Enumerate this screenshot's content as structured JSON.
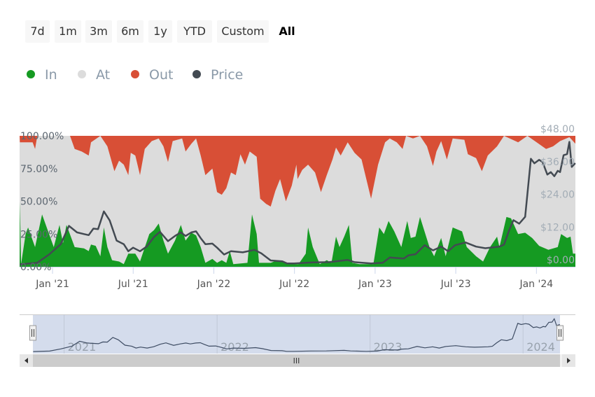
{
  "range_selector": {
    "buttons": [
      "7d",
      "1m",
      "3m",
      "6m",
      "1y",
      "YTD",
      "Custom",
      "All"
    ],
    "selected": "All"
  },
  "legend": [
    {
      "label": "In",
      "color": "#159a22"
    },
    {
      "label": "At",
      "color": "#dcdcdc"
    },
    {
      "label": "Out",
      "color": "#d84f36"
    },
    {
      "label": "Price",
      "color": "#434a52"
    }
  ],
  "navigator": {
    "year_labels": [
      "2021",
      "2022",
      "2023",
      "2024"
    ],
    "scrollbar_grip": "III"
  },
  "chart_data": {
    "type": "area",
    "x_unit": "months since Jan 2021",
    "xlim": [
      -2.45,
      38.9
    ],
    "x_ticks": [
      {
        "m": 0,
        "label": "Jan '21"
      },
      {
        "m": 6,
        "label": "Jul '21"
      },
      {
        "m": 12,
        "label": "Jan '22"
      },
      {
        "m": 18,
        "label": "Jul '22"
      },
      {
        "m": 24,
        "label": "Jan '23"
      },
      {
        "m": 30,
        "label": "Jul '23"
      },
      {
        "m": 36,
        "label": "Jan '24"
      }
    ],
    "y_left": {
      "ticks": [
        "0.00%",
        "25.00%",
        "50.00%",
        "75.00%",
        "100.00%"
      ],
      "range": [
        0,
        100
      ]
    },
    "y_right": {
      "ticks": [
        "$0.00",
        "$12.00",
        "$24.00",
        "$36.00",
        "$48.00"
      ],
      "range": [
        0,
        48
      ]
    },
    "series": [
      {
        "name": "In",
        "unit": "%",
        "points": [
          [
            -2.43,
            50
          ],
          [
            -2.34,
            2
          ],
          [
            -2.0,
            25
          ],
          [
            -1.82,
            30
          ],
          [
            -1.3,
            15
          ],
          [
            -0.78,
            40
          ],
          [
            -0.26,
            25
          ],
          [
            0.09,
            15
          ],
          [
            0.52,
            32
          ],
          [
            0.78,
            18
          ],
          [
            1.04,
            32
          ],
          [
            1.65,
            15
          ],
          [
            2.34,
            14
          ],
          [
            2.69,
            12
          ],
          [
            2.86,
            17
          ],
          [
            3.21,
            16
          ],
          [
            3.56,
            8
          ],
          [
            3.82,
            30
          ],
          [
            4.08,
            15
          ],
          [
            4.43,
            5
          ],
          [
            4.95,
            4
          ],
          [
            5.3,
            2
          ],
          [
            5.64,
            10
          ],
          [
            6.16,
            10
          ],
          [
            6.51,
            4
          ],
          [
            7.2,
            25
          ],
          [
            7.55,
            28
          ],
          [
            7.9,
            33
          ],
          [
            8.25,
            20
          ],
          [
            8.59,
            10
          ],
          [
            9.11,
            20
          ],
          [
            9.55,
            32
          ],
          [
            9.9,
            20
          ],
          [
            10.33,
            26
          ],
          [
            10.68,
            24
          ],
          [
            11.02,
            15
          ],
          [
            11.37,
            3
          ],
          [
            11.89,
            6
          ],
          [
            12.24,
            3
          ],
          [
            12.59,
            5
          ],
          [
            12.93,
            3
          ],
          [
            13.19,
            12
          ],
          [
            13.45,
            2
          ],
          [
            14.5,
            3
          ],
          [
            14.84,
            40
          ],
          [
            15.19,
            25
          ],
          [
            15.36,
            3
          ],
          [
            16.23,
            3
          ],
          [
            16.75,
            5
          ],
          [
            17.62,
            2
          ],
          [
            18.3,
            2
          ],
          [
            18.84,
            10
          ],
          [
            19.01,
            30
          ],
          [
            19.36,
            15
          ],
          [
            19.88,
            2
          ],
          [
            20.4,
            5
          ],
          [
            20.75,
            3
          ],
          [
            21.09,
            23
          ],
          [
            21.35,
            15
          ],
          [
            21.7,
            23
          ],
          [
            22.05,
            32
          ],
          [
            22.31,
            3
          ],
          [
            22.83,
            2
          ],
          [
            23.87,
            2
          ],
          [
            24.31,
            30
          ],
          [
            24.65,
            25
          ],
          [
            25.0,
            35
          ],
          [
            25.43,
            27
          ],
          [
            25.95,
            15
          ],
          [
            26.39,
            35
          ],
          [
            26.65,
            22
          ],
          [
            27.0,
            23
          ],
          [
            27.34,
            38
          ],
          [
            28.04,
            15
          ],
          [
            28.39,
            8
          ],
          [
            28.91,
            22
          ],
          [
            29.25,
            8
          ],
          [
            29.77,
            30
          ],
          [
            30.47,
            27
          ],
          [
            30.82,
            15
          ],
          [
            31.51,
            8
          ],
          [
            32.03,
            4
          ],
          [
            32.55,
            15
          ],
          [
            33.07,
            23
          ],
          [
            33.25,
            15
          ],
          [
            33.77,
            38
          ],
          [
            34.11,
            37
          ],
          [
            34.64,
            25
          ],
          [
            35.16,
            26
          ],
          [
            35.68,
            22
          ],
          [
            36.2,
            16
          ],
          [
            36.89,
            13
          ],
          [
            37.59,
            15
          ],
          [
            37.84,
            25
          ],
          [
            38.28,
            22
          ],
          [
            38.54,
            23
          ],
          [
            38.72,
            10
          ],
          [
            38.9,
            10
          ]
        ]
      },
      {
        "name": "Out",
        "unit": "%",
        "points": [
          [
            -2.43,
            5
          ],
          [
            -1.48,
            5
          ],
          [
            -1.3,
            10
          ],
          [
            -1.13,
            0
          ],
          [
            1.3,
            0
          ],
          [
            1.65,
            10
          ],
          [
            2.17,
            12
          ],
          [
            2.69,
            15
          ],
          [
            2.86,
            5
          ],
          [
            3.56,
            0
          ],
          [
            4.08,
            8
          ],
          [
            4.6,
            27
          ],
          [
            4.95,
            19
          ],
          [
            5.3,
            22
          ],
          [
            5.64,
            30
          ],
          [
            5.82,
            13
          ],
          [
            6.16,
            15
          ],
          [
            6.51,
            30
          ],
          [
            6.86,
            10
          ],
          [
            7.38,
            4
          ],
          [
            7.9,
            2
          ],
          [
            8.25,
            8
          ],
          [
            8.59,
            20
          ],
          [
            8.94,
            4
          ],
          [
            9.64,
            2
          ],
          [
            9.9,
            12
          ],
          [
            10.33,
            6
          ],
          [
            10.68,
            2
          ],
          [
            11.02,
            15
          ],
          [
            11.37,
            30
          ],
          [
            11.89,
            25
          ],
          [
            12.24,
            43
          ],
          [
            12.59,
            45
          ],
          [
            12.93,
            40
          ],
          [
            13.28,
            28
          ],
          [
            13.63,
            30
          ],
          [
            13.98,
            14
          ],
          [
            14.32,
            22
          ],
          [
            14.67,
            12
          ],
          [
            15.19,
            16
          ],
          [
            15.45,
            48
          ],
          [
            15.89,
            52
          ],
          [
            16.23,
            54
          ],
          [
            16.58,
            42
          ],
          [
            16.93,
            33
          ],
          [
            17.36,
            50
          ],
          [
            17.8,
            38
          ],
          [
            18.14,
            22
          ],
          [
            18.23,
            33
          ],
          [
            18.58,
            26
          ],
          [
            19.01,
            22
          ],
          [
            19.53,
            28
          ],
          [
            19.97,
            43
          ],
          [
            20.4,
            30
          ],
          [
            20.83,
            18
          ],
          [
            21.09,
            9
          ],
          [
            21.44,
            15
          ],
          [
            21.96,
            5
          ],
          [
            22.47,
            13
          ],
          [
            22.99,
            18
          ],
          [
            23.7,
            48
          ],
          [
            24.22,
            22
          ],
          [
            24.74,
            5
          ],
          [
            25.09,
            2
          ],
          [
            25.61,
            5
          ],
          [
            26.04,
            10
          ],
          [
            26.3,
            0
          ],
          [
            26.82,
            2
          ],
          [
            27.34,
            0
          ],
          [
            27.86,
            8
          ],
          [
            28.3,
            23
          ],
          [
            28.56,
            12
          ],
          [
            28.91,
            4
          ],
          [
            29.34,
            18
          ],
          [
            29.77,
            2
          ],
          [
            30.64,
            3
          ],
          [
            30.9,
            14
          ],
          [
            31.51,
            17
          ],
          [
            31.94,
            27
          ],
          [
            32.38,
            15
          ],
          [
            33.07,
            8
          ],
          [
            33.59,
            0
          ],
          [
            34.64,
            5
          ],
          [
            35.33,
            0
          ],
          [
            36.72,
            10
          ],
          [
            37.24,
            8
          ],
          [
            37.76,
            4
          ],
          [
            38.45,
            1
          ],
          [
            38.9,
            6
          ]
        ]
      },
      {
        "name": "Price",
        "unit": "USD",
        "points": [
          [
            -2.43,
            0.9
          ],
          [
            -1.13,
            1.5
          ],
          [
            -0.26,
            4.5
          ],
          [
            0.61,
            8.3
          ],
          [
            1.22,
            15
          ],
          [
            1.82,
            12.6
          ],
          [
            2.34,
            12
          ],
          [
            2.69,
            11.6
          ],
          [
            3.04,
            14
          ],
          [
            3.39,
            13.8
          ],
          [
            3.82,
            20.3
          ],
          [
            4.25,
            17
          ],
          [
            4.77,
            9.6
          ],
          [
            5.3,
            8.3
          ],
          [
            5.64,
            5.7
          ],
          [
            5.99,
            7
          ],
          [
            6.51,
            5.7
          ],
          [
            7.03,
            7.5
          ],
          [
            7.55,
            10.9
          ],
          [
            7.99,
            12.8
          ],
          [
            8.59,
            9.4
          ],
          [
            9.11,
            11.3
          ],
          [
            9.55,
            12.6
          ],
          [
            9.9,
            11.3
          ],
          [
            10.33,
            12.6
          ],
          [
            10.68,
            13
          ],
          [
            11.02,
            10.5
          ],
          [
            11.37,
            8.3
          ],
          [
            11.89,
            8.5
          ],
          [
            12.24,
            7
          ],
          [
            12.76,
            4.5
          ],
          [
            13.28,
            5.7
          ],
          [
            14.15,
            5.3
          ],
          [
            15.02,
            6.2
          ],
          [
            15.54,
            4.9
          ],
          [
            16.23,
            2.3
          ],
          [
            17.1,
            2
          ],
          [
            17.45,
            1.2
          ],
          [
            17.97,
            1.2
          ],
          [
            19.36,
            1.6
          ],
          [
            20.57,
            1.7
          ],
          [
            21.96,
            2.5
          ],
          [
            22.47,
            1.7
          ],
          [
            23.7,
            1.2
          ],
          [
            24.57,
            1.5
          ],
          [
            25.09,
            3.4
          ],
          [
            26.13,
            3.0
          ],
          [
            26.48,
            4.2
          ],
          [
            27.0,
            4.6
          ],
          [
            27.69,
            7.9
          ],
          [
            28.3,
            6
          ],
          [
            28.91,
            7.4
          ],
          [
            29.43,
            5.7
          ],
          [
            29.95,
            7.9
          ],
          [
            30.73,
            8.9
          ],
          [
            31.51,
            7.4
          ],
          [
            32.2,
            6.8
          ],
          [
            33.25,
            7.4
          ],
          [
            33.59,
            8.1
          ],
          [
            33.94,
            13
          ],
          [
            34.29,
            17.1
          ],
          [
            34.72,
            15.8
          ],
          [
            35.16,
            18.3
          ],
          [
            35.59,
            39.6
          ],
          [
            35.85,
            37.9
          ],
          [
            36.2,
            39.2
          ],
          [
            36.46,
            38.4
          ],
          [
            36.81,
            33.8
          ],
          [
            37.07,
            34.7
          ],
          [
            37.33,
            33.2
          ],
          [
            37.59,
            35.2
          ],
          [
            37.76,
            34.7
          ],
          [
            38.02,
            40.9
          ],
          [
            38.28,
            41.3
          ],
          [
            38.45,
            45.8
          ],
          [
            38.63,
            36.6
          ],
          [
            38.89,
            38.0
          ]
        ]
      }
    ]
  }
}
